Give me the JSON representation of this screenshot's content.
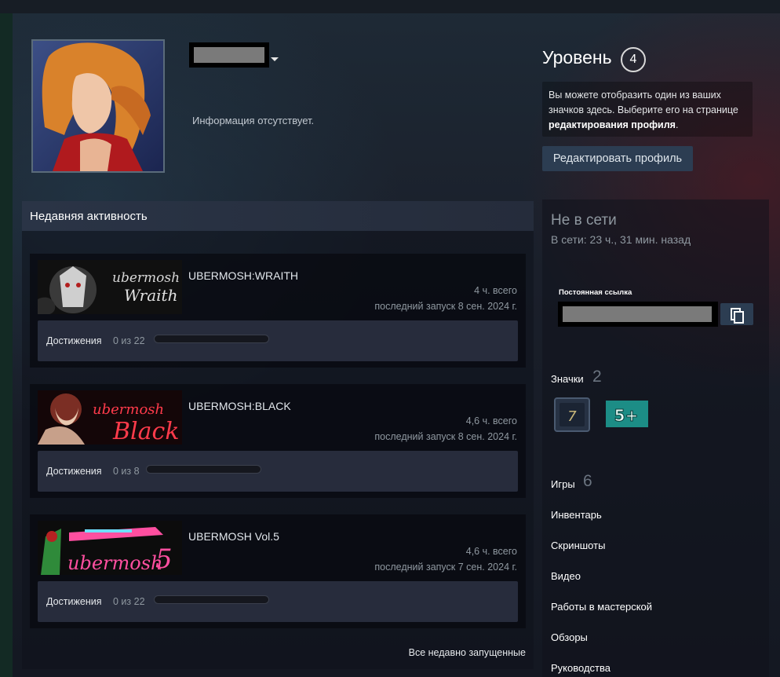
{
  "profile": {
    "summary": "Информация отсутствует."
  },
  "level": {
    "label": "Уровень",
    "value": "4",
    "badge_info_text": "Вы можете отобразить один из ваших значков здесь. Выберите его на странице ",
    "badge_info_link": "редактирования профиля",
    "badge_info_end": ".",
    "edit_button": "Редактировать профиль"
  },
  "activity": {
    "title": "Недавняя активность",
    "achievements_label": "Достижения",
    "all_recent": "Все недавно запущенные",
    "games": [
      {
        "name": "UBERMOSH:WRAITH",
        "hours": "4 ч. всего",
        "last_played": "последний запуск 8 сен. 2024 г.",
        "achievements": "0 из 22",
        "achievement_progress": 0
      },
      {
        "name": "UBERMOSH:BLACK",
        "hours": "4,6 ч. всего",
        "last_played": "последний запуск 8 сен. 2024 г.",
        "achievements": "0 из 8",
        "achievement_progress": 0
      },
      {
        "name": "UBERMOSH Vol.5",
        "hours": "4,6 ч. всего",
        "last_played": "последний запуск 7 сен. 2024 г.",
        "achievements": "0 из 22",
        "achievement_progress": 0
      }
    ]
  },
  "sidebar": {
    "status": "Не в сети",
    "last_online": "В сети: 23 ч., 31 мин. назад",
    "permalink_label": "Постоянная ссылка",
    "badges_label": "Значки",
    "badges_count": "2",
    "games_label": "Игры",
    "games_count": "6",
    "links": [
      "Инвентарь",
      "Скриншоты",
      "Видео",
      "Работы в мастерской",
      "Обзоры",
      "Руководства"
    ]
  },
  "colors": {
    "page_bg": "#1b2838",
    "button_bg": "#2c3d52",
    "muted_text": "#8f98a0",
    "badge_teal": "#1c8d86"
  },
  "icons": {
    "copy": "copy-icon",
    "dropdown": "caret-down-icon"
  }
}
